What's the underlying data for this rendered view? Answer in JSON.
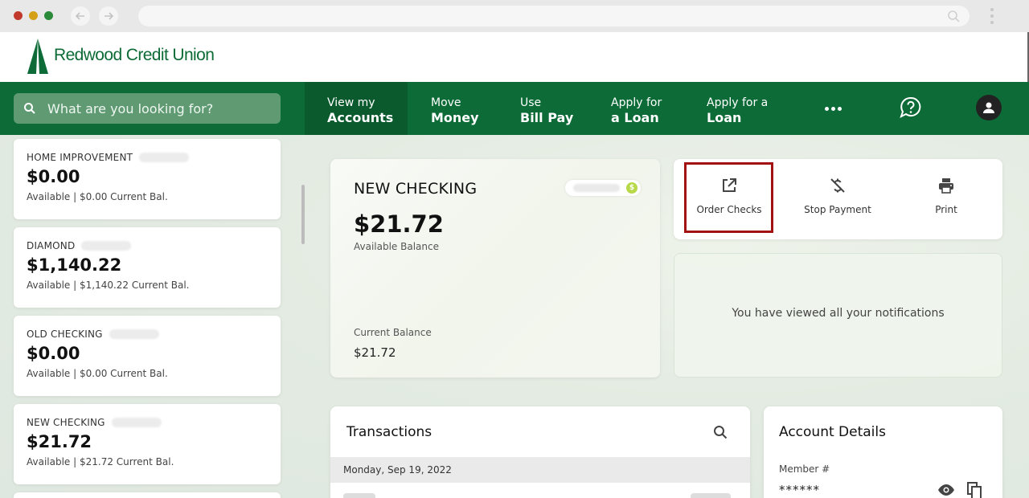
{
  "brand": {
    "name": "Redwood Credit Union",
    "primary_color": "#0c6b36",
    "highlight_color": "#a31212"
  },
  "search": {
    "placeholder": "What are you looking for?"
  },
  "nav": {
    "items": [
      {
        "line1": "View my",
        "line2": "Accounts",
        "active": true
      },
      {
        "line1": "Move",
        "line2": "Money",
        "active": false
      },
      {
        "line1": "Use",
        "line2": "Bill Pay",
        "active": false
      },
      {
        "line1": "Apply for",
        "line2": "a Loan",
        "active": false
      },
      {
        "line1": "Apply for a",
        "line2": "Loan",
        "active": false
      }
    ]
  },
  "accounts": [
    {
      "name": "HOME IMPROVEMENT",
      "amount": "$0.00",
      "detail": "Available  |  $0.00 Current Bal."
    },
    {
      "name": "DIAMOND",
      "amount": "$1,140.22",
      "detail": "Available  |  $1,140.22 Current Bal."
    },
    {
      "name": "OLD CHECKING",
      "amount": "$0.00",
      "detail": "Available  |  $0.00 Current Bal."
    },
    {
      "name": "NEW CHECKING",
      "amount": "$21.72",
      "detail": "Available  |  $21.72 Current Bal."
    }
  ],
  "selected_account": {
    "name": "NEW CHECKING",
    "balance": "$21.72",
    "balance_label": "Available Balance",
    "current_label": "Current Balance",
    "current_value": "$21.72",
    "coin_symbol": "$"
  },
  "actions": [
    {
      "label": "Order Checks",
      "icon": "external-link-icon"
    },
    {
      "label": "Stop Payment",
      "icon": "no-money-icon"
    },
    {
      "label": "Print",
      "icon": "printer-icon"
    }
  ],
  "notifications": {
    "message": "You have viewed all your notifications"
  },
  "transactions": {
    "title": "Transactions",
    "date_header": "Monday, Sep 19, 2022"
  },
  "account_details": {
    "title": "Account Details",
    "member_label": "Member #",
    "member_value": "******"
  }
}
